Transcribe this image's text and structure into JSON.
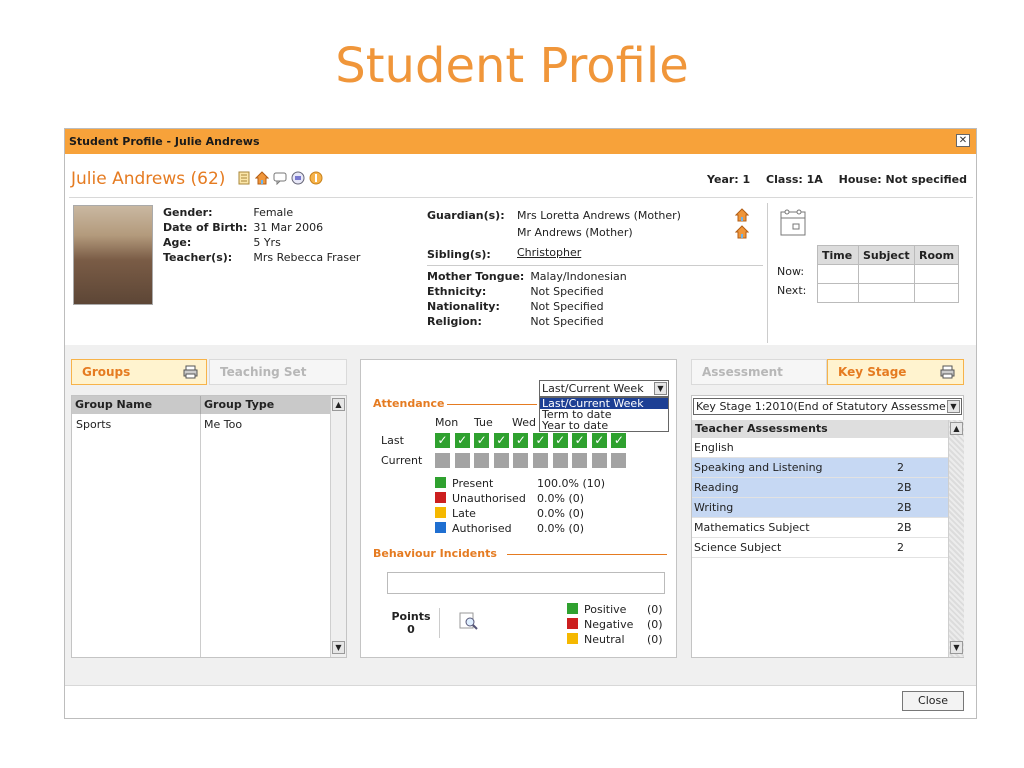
{
  "slide_title": "Student Profile",
  "window": {
    "title": "Student Profile - Julie Andrews"
  },
  "header": {
    "student_name": "Julie Andrews (62)",
    "year": "Year: 1",
    "class": "Class: 1A",
    "house": "House: Not specified"
  },
  "student": {
    "gender_label": "Gender:",
    "gender": "Female",
    "dob_label": "Date of Birth:",
    "dob": "31 Mar 2006",
    "age_label": "Age:",
    "age": "5 Yrs",
    "teacher_label": "Teacher(s):",
    "teacher": "Mrs Rebecca Fraser"
  },
  "family": {
    "guardian_label": "Guardian(s):",
    "guardian1": "Mrs Loretta Andrews (Mother)",
    "guardian2": "Mr Andrews (Mother)",
    "sibling_label": "Sibling(s):",
    "sibling": "Christopher",
    "mother_tongue_label": "Mother Tongue:",
    "mother_tongue": "Malay/Indonesian",
    "ethnicity_label": "Ethnicity:",
    "ethnicity": "Not Specified",
    "nationality_label": "Nationality:",
    "nationality": "Not Specified",
    "religion_label": "Religion:",
    "religion": "Not Specified"
  },
  "timetable": {
    "headers": [
      "Time",
      "Subject",
      "Room"
    ],
    "now_label": "Now:",
    "next_label": "Next:"
  },
  "groups_panel": {
    "tab_groups": "Groups",
    "tab_teaching_set": "Teaching Set",
    "col_group_name": "Group Name",
    "col_group_type": "Group Type",
    "rows": [
      {
        "name": "Sports",
        "type": "Me Too"
      }
    ]
  },
  "attendance": {
    "title": "Attendance",
    "dropdown_selected": "Last/Current Week",
    "dropdown_options": [
      "Last/Current Week",
      "Term to date",
      "Year to date"
    ],
    "days": [
      "Mon",
      "Tue",
      "Wed"
    ],
    "last_label": "Last",
    "current_label": "Current",
    "legend": [
      {
        "label": "Present",
        "value": "100.0% (10)",
        "color": "#2fa12f"
      },
      {
        "label": "Unauthorised",
        "value": "0.0% (0)",
        "color": "#cc1f1f"
      },
      {
        "label": "Late",
        "value": "0.0% (0)",
        "color": "#f5b800"
      },
      {
        "label": "Authorised",
        "value": "0.0% (0)",
        "color": "#1f6fd1"
      }
    ]
  },
  "behaviour": {
    "title": "Behaviour Incidents",
    "points_label": "Points",
    "points_value": "0",
    "legend": [
      {
        "label": "Positive",
        "value": "(0)",
        "color": "#2fa12f"
      },
      {
        "label": "Negative",
        "value": "(0)",
        "color": "#cc1f1f"
      },
      {
        "label": "Neutral",
        "value": "(0)",
        "color": "#f5b800"
      }
    ]
  },
  "assessment_panel": {
    "tab_assessment": "Assessment",
    "tab_key_stage": "Key Stage",
    "select_value": "Key Stage 1:2010(End of Statutory Assessme",
    "section_header": "Teacher Assessments",
    "rows": [
      {
        "subject": "English",
        "value": "",
        "highlight": false
      },
      {
        "subject": "Speaking and Listening",
        "value": "2",
        "highlight": true
      },
      {
        "subject": "Reading",
        "value": "2B",
        "highlight": true
      },
      {
        "subject": "Writing",
        "value": "2B",
        "highlight": true
      },
      {
        "subject": "Mathematics Subject",
        "value": "2B",
        "highlight": false
      },
      {
        "subject": "Science Subject",
        "value": "2",
        "highlight": false
      }
    ]
  },
  "footer": {
    "close_label": "Close"
  }
}
